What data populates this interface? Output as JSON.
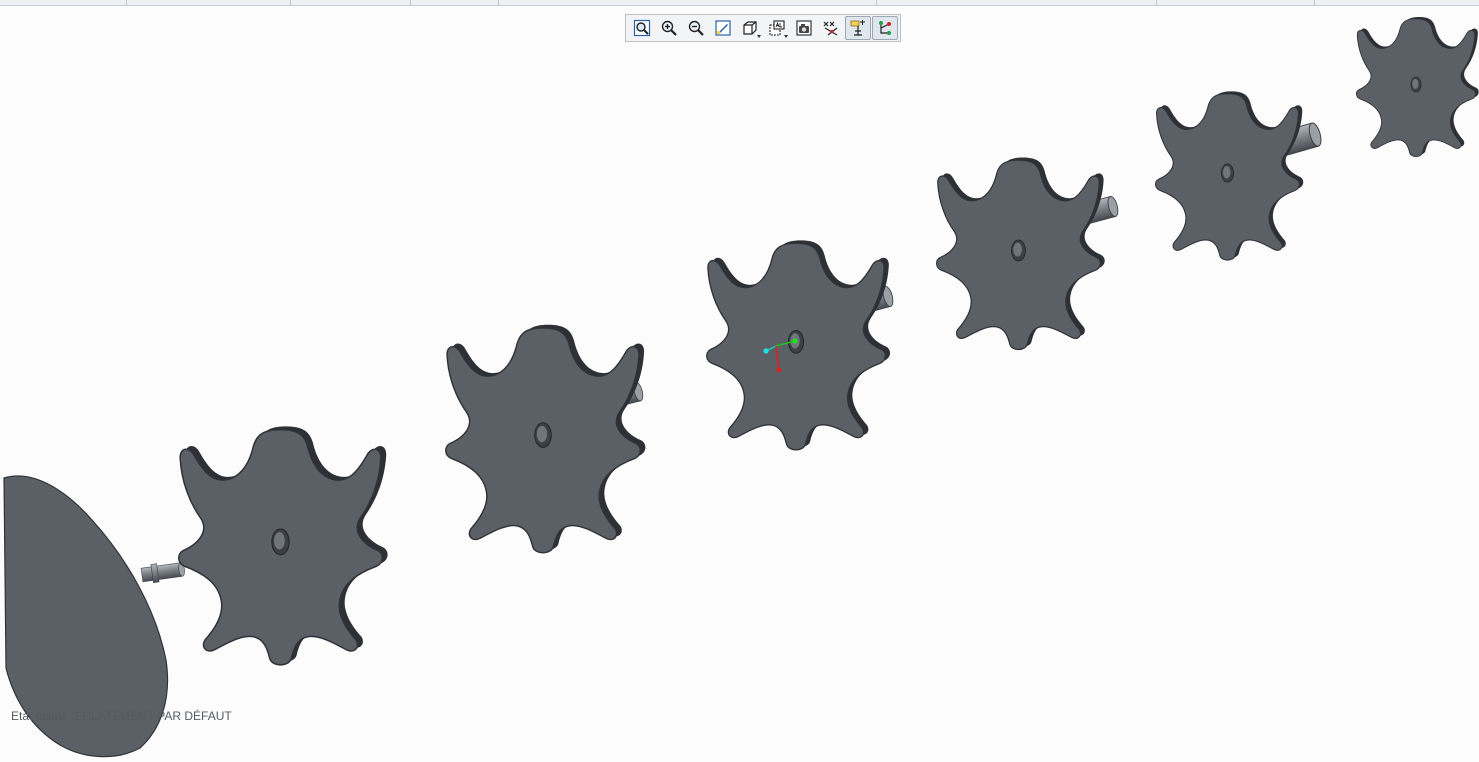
{
  "status": {
    "exploded_state": "Etat éclaté :ECLATEMENT PAR DÉFAUT"
  },
  "toolbar": {
    "buttons": [
      {
        "icon": "zoom-fit-icon",
        "label": "Zoom to fit"
      },
      {
        "icon": "zoom-in-icon",
        "label": "Zoom in"
      },
      {
        "icon": "zoom-out-icon",
        "label": "Zoom out"
      },
      {
        "icon": "repaint-icon",
        "label": "Repaint"
      },
      {
        "icon": "saved-orientations-icon",
        "label": "Saved orientations"
      },
      {
        "icon": "display-style-icon",
        "label": "Display style"
      },
      {
        "icon": "view-manager-icon",
        "label": "View manager"
      },
      {
        "icon": "datum-display-icon",
        "label": "Datum display"
      },
      {
        "icon": "spin-center-icon",
        "label": "Spin center",
        "active": true
      },
      {
        "icon": "explode-lines-icon",
        "label": "Explode lines",
        "active": true
      }
    ]
  },
  "colors": {
    "background": "#fcfcfc",
    "part_face": "#5b6066",
    "part_edge": "#2f3338",
    "part_highlight": "#8a9097",
    "axis_x": "#e02020",
    "axis_y": "#20c020",
    "axis_z": "#20c0c0"
  }
}
